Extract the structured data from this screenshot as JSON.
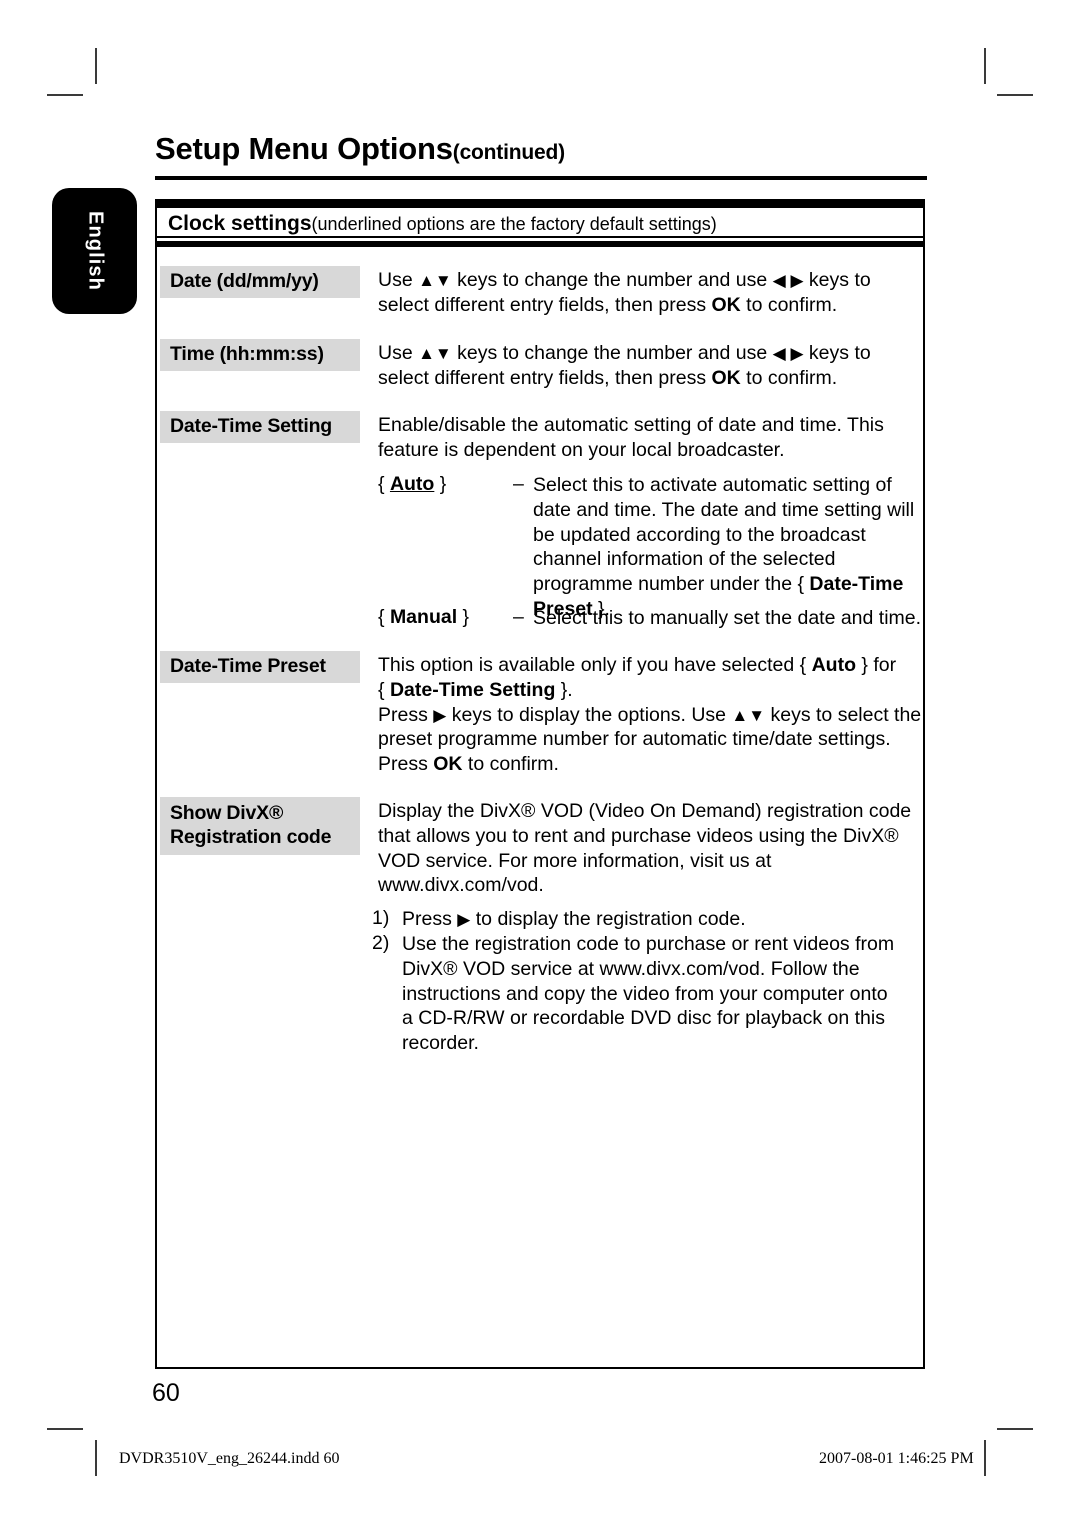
{
  "page": {
    "heading_main": "Setup Menu Options",
    "heading_suffix": "(continued)",
    "language_tab": "English",
    "page_number": "60"
  },
  "table": {
    "header_title": "Clock settings",
    "header_note": "(underlined options are the factory default settings)",
    "rows": [
      {
        "label": "Date (dd/mm/yy)",
        "body_pre": "Use ",
        "body_arrows1": "▲▼",
        "body_mid": " keys to change the number and use ",
        "body_arrows2": "◀ ▶",
        "body_post": " keys to select different entry fields, then press ",
        "body_bold": "OK",
        "body_end": " to confirm."
      },
      {
        "label": "Time (hh:mm:ss)",
        "body_pre": "Use ",
        "body_arrows1": "▲▼",
        "body_mid": " keys to change the number and use ",
        "body_arrows2": "◀ ▶",
        "body_post": " keys to select different entry fields, then press ",
        "body_bold": "OK",
        "body_end": " to confirm."
      }
    ],
    "date_time_setting": {
      "label": "Date-Time Setting",
      "intro": "Enable/disable the automatic setting of date and time. This feature is dependent on your local broadcaster.",
      "options": [
        {
          "brace_open": "{ ",
          "name": "Auto",
          "brace_close": " }",
          "dash": "–",
          "desc_pre": "Select this to activate automatic setting of date and time. The date and time setting will be updated according to the broadcast channel information of the selected programme number under the { ",
          "desc_bold": "Date-Time Preset",
          "desc_post": " }."
        },
        {
          "brace_open": "{ ",
          "name": "Manual",
          "brace_close": " }",
          "dash": "–",
          "desc_pre": "Select this to manually set the date and time.",
          "desc_bold": "",
          "desc_post": ""
        }
      ]
    },
    "date_time_preset": {
      "label": "Date-Time Preset",
      "line1_pre": "This option is available only if you have selected { ",
      "line1_bold": "Auto",
      "line1_post": " } for",
      "line2_pre": "{ ",
      "line2_bold": "Date-Time Setting",
      "line2_post": " }.",
      "line3_pre": "Press ",
      "line3_arrow": "▶",
      "line3_mid": " keys to display the options. Use ",
      "line3_arrows": "▲▼",
      "line3_post": " keys to select the preset programme number for automatic time/date settings. Press ",
      "line3_bold": "OK",
      "line3_end": " to confirm."
    },
    "show_divx": {
      "label_line1": "Show DivX®",
      "label_line2": "Registration code",
      "body": "Display the DivX® VOD (Video On Demand) registration code that allows you to rent and purchase videos using the DivX® VOD service. For more information, visit us at www.divx.com/vod.",
      "steps": [
        {
          "number": "1)",
          "text_pre": "Press ",
          "arrow": "▶",
          "text_post": " to display the registration code."
        },
        {
          "number": "2)",
          "text_pre": "Use the registration code to purchase or rent videos from DivX® VOD service at www.divx.com/vod. Follow the instructions and copy the video from your computer onto a CD-R/RW or recordable DVD disc for playback on this recorder.",
          "arrow": "",
          "text_post": ""
        }
      ]
    }
  },
  "footer": {
    "file_name": "DVDR3510V_eng_26244.indd   60",
    "timestamp": "2007-08-01   1:46:25 PM"
  }
}
